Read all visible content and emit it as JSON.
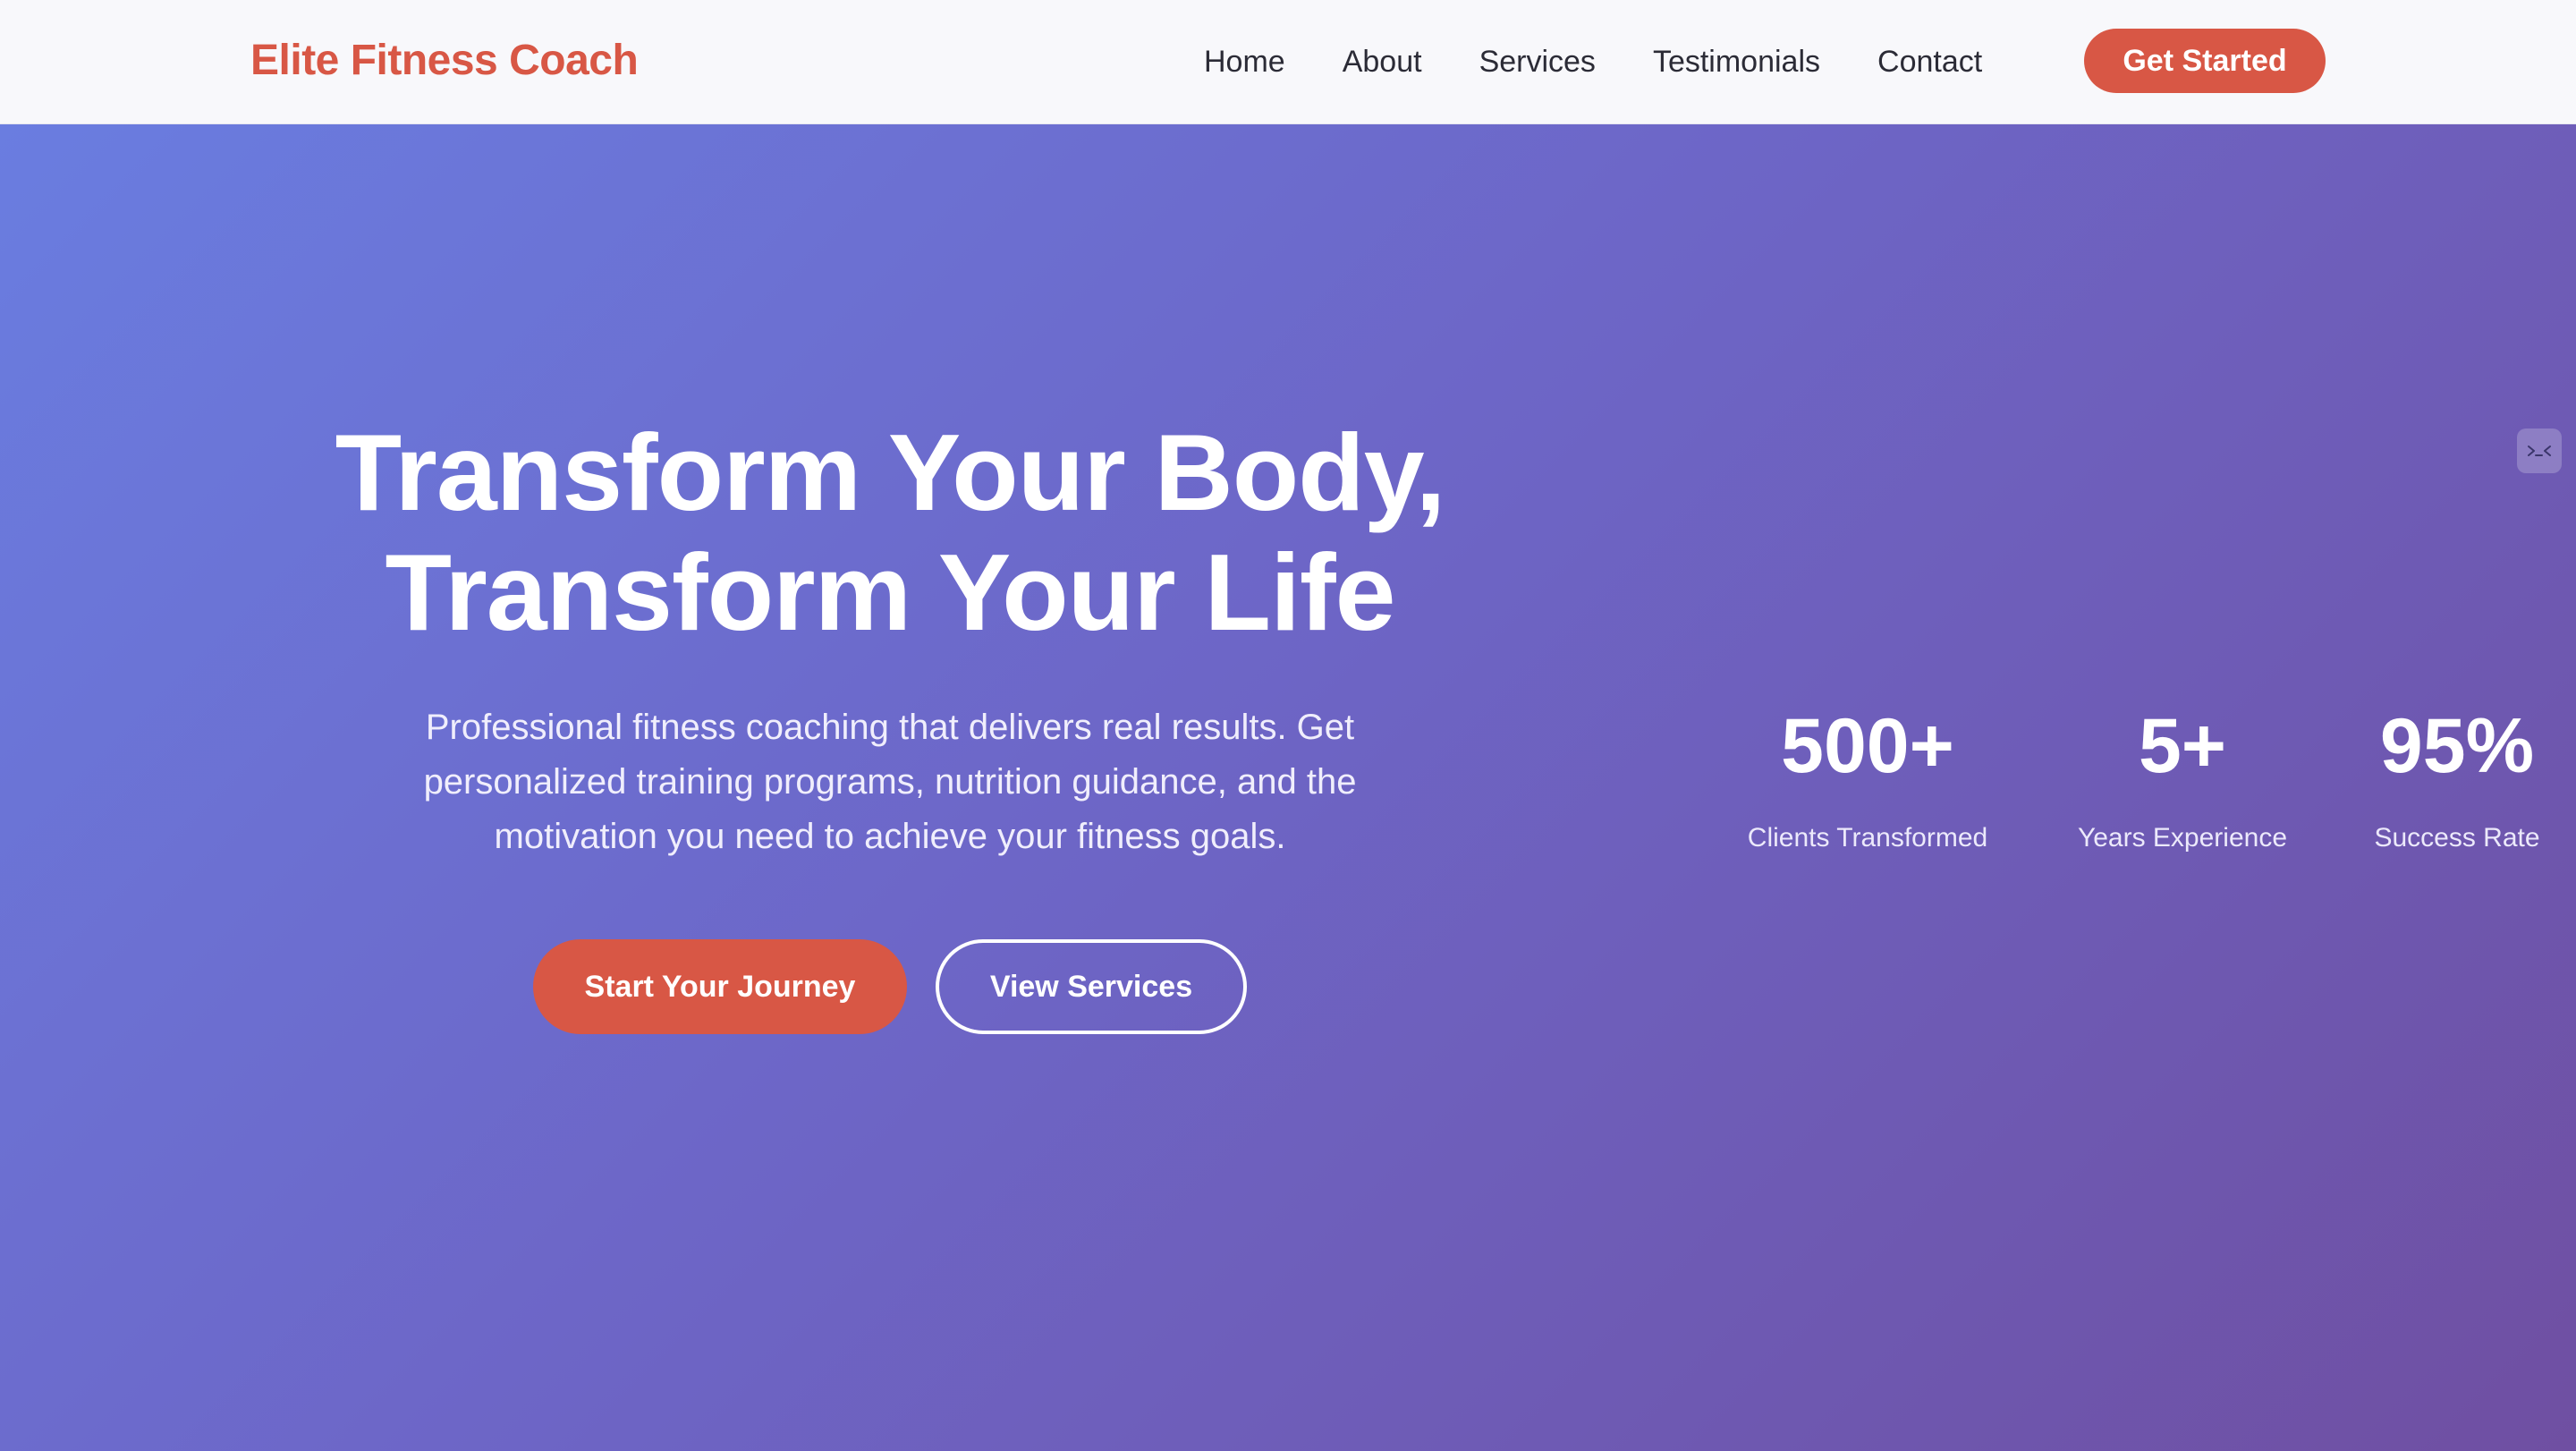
{
  "header": {
    "brand": "Elite Fitness Coach",
    "nav": [
      {
        "label": "Home"
      },
      {
        "label": "About"
      },
      {
        "label": "Services"
      },
      {
        "label": "Testimonials"
      },
      {
        "label": "Contact"
      }
    ],
    "cta_label": "Get Started"
  },
  "hero": {
    "title_line1": "Transform Your Body,",
    "title_line2": "Transform Your Life",
    "subtitle": "Professional fitness coaching that delivers real results. Get personalized training programs, nutrition guidance, and the motivation you need to achieve your fitness goals.",
    "primary_button": "Start Your Journey",
    "secondary_button": "View Services"
  },
  "stats": [
    {
      "value": "500+",
      "label": "Clients Transformed"
    },
    {
      "value": "5+",
      "label": "Years Experience"
    },
    {
      "value": "95%",
      "label": "Success Rate"
    }
  ],
  "side_widget": {
    "icon": "code-icon"
  },
  "colors": {
    "accent": "#d85745",
    "navbar_bg": "#f8f8fb",
    "hero_gradient_start": "#6a7de0",
    "hero_gradient_end": "#6f4fa2",
    "nav_text": "#2b2b36"
  }
}
